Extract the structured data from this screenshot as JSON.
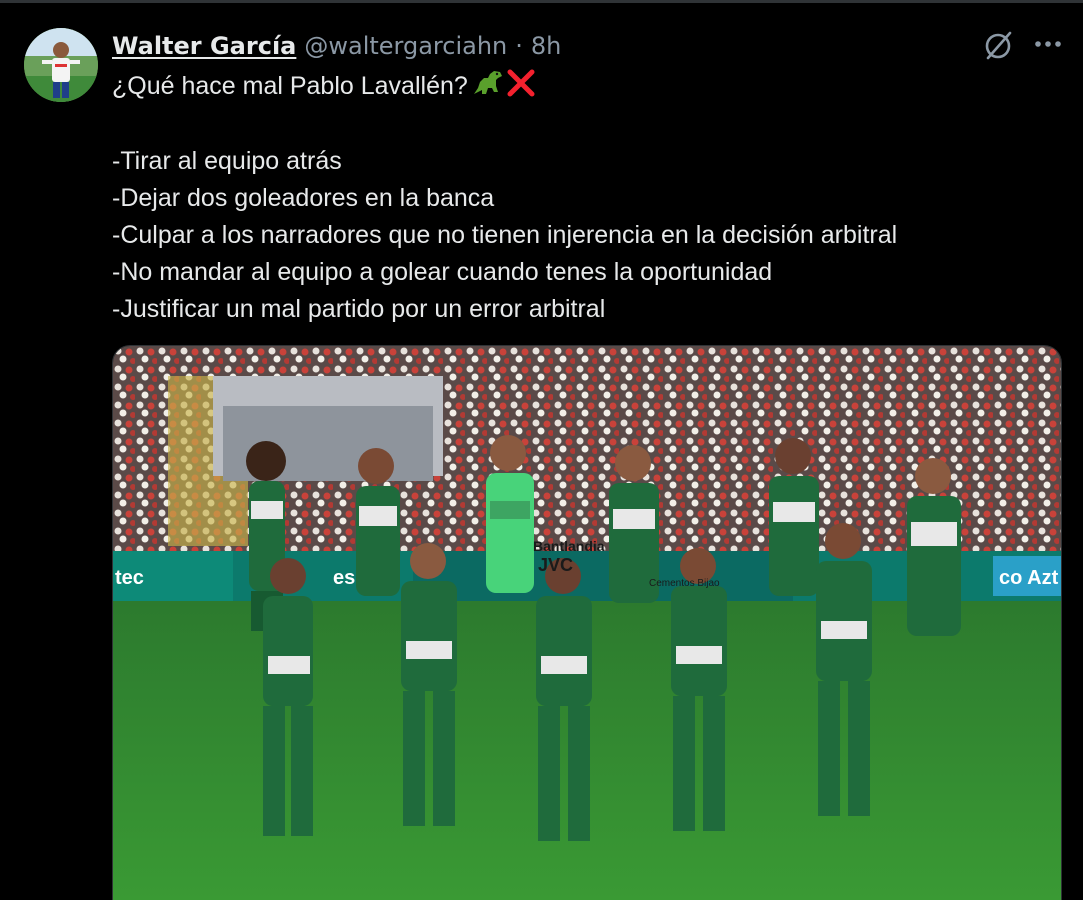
{
  "tweet": {
    "author": {
      "display_name": "Walter García",
      "handle": "@waltergarciahn",
      "separator": "·",
      "time": "8h"
    },
    "lines": [
      "¿Qué hace mal Pablo Lavallén?",
      "",
      "-Tirar al equipo atrás",
      "-Dejar dos goleadores en la banca",
      "-Culpar a los narradores que no tienen injerencia en la decisión arbitral",
      "-No mandar al equipo a golear cuando tenes la oportunidad",
      "-Justificar un mal partido por un error arbitral"
    ],
    "emojis": [
      "dinosaur-emoji",
      "red-cross-emoji"
    ]
  },
  "media": {
    "sponsor_text": "Bantlandia",
    "jersey_text": "JVC",
    "sub_text": "Cementos Bijao",
    "board_text": "co Azt",
    "board_text_left": "tec",
    "board_text_mid": "eso"
  },
  "icons": {
    "grok": "grok-slash-icon",
    "more": "more-dots-icon"
  },
  "colors": {
    "background": "#000000",
    "text": "#e7e9ea",
    "muted": "#8b98a5",
    "jersey": "#1f6b3c",
    "pitch": "#2f8a2f"
  }
}
